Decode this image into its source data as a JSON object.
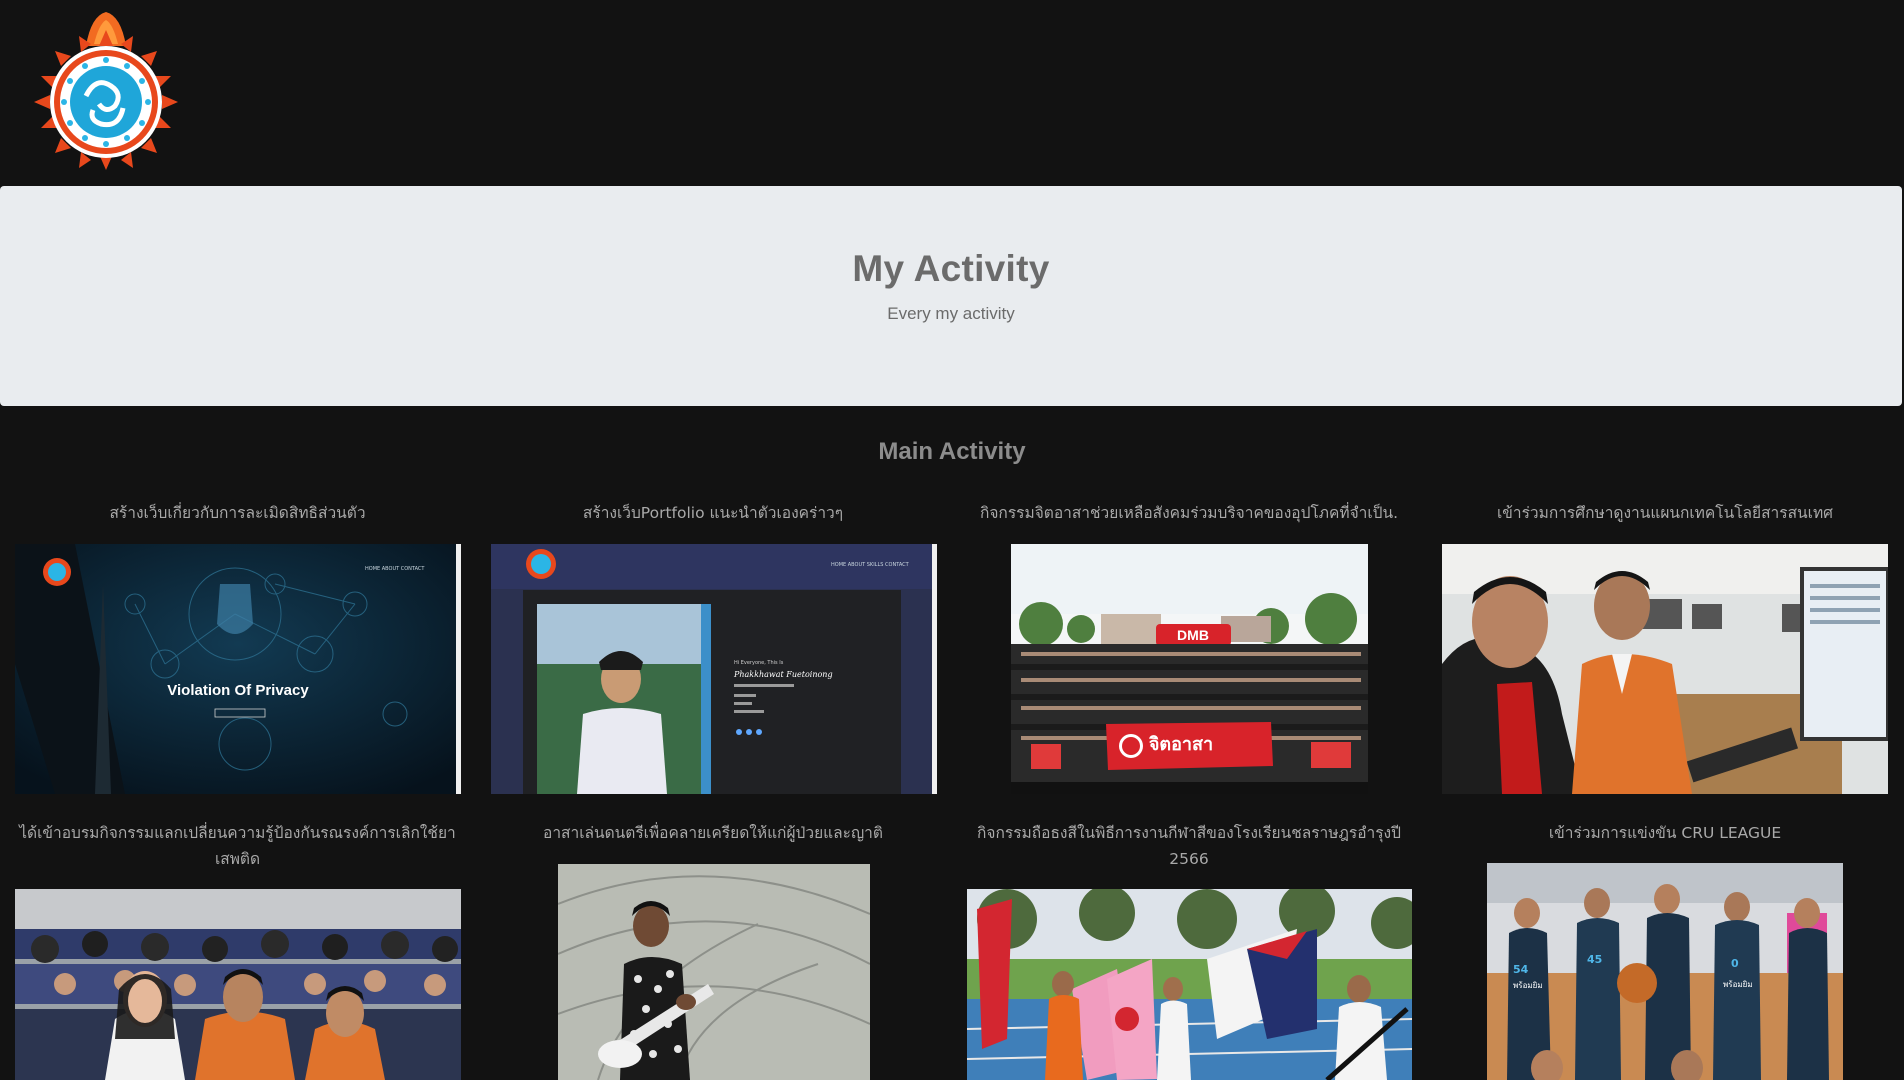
{
  "header": {
    "logo_icon": "school-seal-logo"
  },
  "hero": {
    "title": "My Activity",
    "subtitle": "Every my activity"
  },
  "main": {
    "title": "Main Activity",
    "activities": [
      {
        "caption": "สร้างเว็บเกี่ยวกับการละเมิดสิทธิส่วนตัว",
        "image_text": "Violation Of Privacy"
      },
      {
        "caption": "สร้างเว็บPortfolio แนะนำตัวเองคร่าวๆ",
        "image_text": "Phakkhawat Fuetoinong"
      },
      {
        "caption": "กิจกรรมจิตอาสาช่วยเหลือสังคมร่วมบริจาคของอุปโภคที่จำเป็น.",
        "image_text": "จิตอาสา"
      },
      {
        "caption": "เข้าร่วมการศึกษาดูงานแผนกเทคโนโลยีสารสนเทศ"
      },
      {
        "caption": "ได้เข้าอบรมกิจกรรมแลกเปลี่ยนความรู้ป้องกันรณรงค์การเลิกใช้ยาเสพติด"
      },
      {
        "caption": "อาสาเล่นดนตรีเพื่อคลายเครียดให้แก่ผู้ป่วยและญาติ"
      },
      {
        "caption": "กิจกรรมถือธงสีในพิธีการงานกีฬาสีของโรงเรียนชลราษฎรอำรุงปี 2566"
      },
      {
        "caption": "เข้าร่วมการแข่งขัน CRU LEAGUE"
      }
    ]
  }
}
